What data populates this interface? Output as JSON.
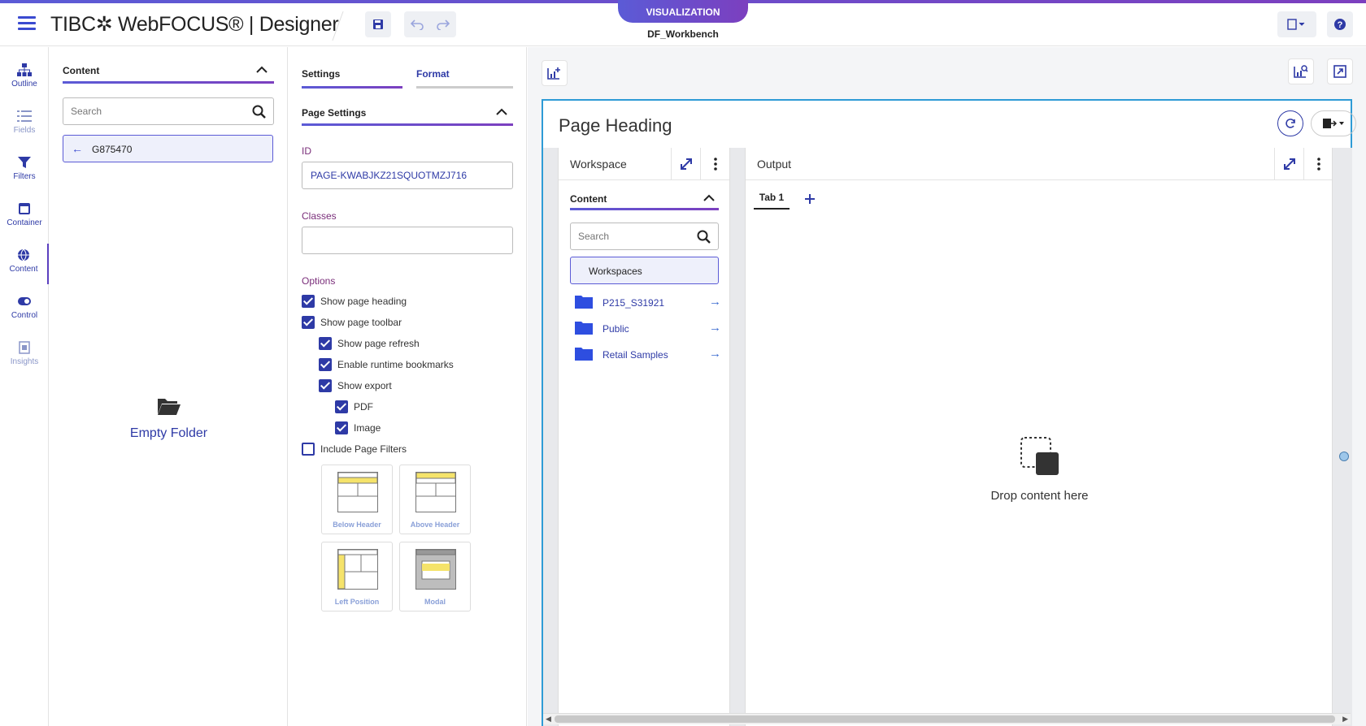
{
  "header": {
    "brand": "TIBC✲ WebFOCUS® | Designer",
    "mode_tab": "VISUALIZATION",
    "workbench_title": "DF_Workbench"
  },
  "rail": {
    "items": [
      {
        "label": "Outline",
        "icon": "sitemap-icon"
      },
      {
        "label": "Fields",
        "icon": "list-icon"
      },
      {
        "label": "Filters",
        "icon": "funnel-icon"
      },
      {
        "label": "Container",
        "icon": "container-icon"
      },
      {
        "label": "Content",
        "icon": "globe-icon"
      },
      {
        "label": "Control",
        "icon": "toggle-icon"
      },
      {
        "label": "Insights",
        "icon": "insights-icon"
      }
    ]
  },
  "content_panel": {
    "title": "Content",
    "search_placeholder": "Search",
    "breadcrumb": "G875470",
    "empty_label": "Empty Folder"
  },
  "settings_panel": {
    "tabs": [
      "Settings",
      "Format"
    ],
    "section_title": "Page Settings",
    "id_label": "ID",
    "id_value": "PAGE-KWABJKZ21SQUOTMZJ716",
    "classes_label": "Classes",
    "classes_value": "",
    "options_label": "Options",
    "options": [
      {
        "label": "Show page heading",
        "checked": true
      },
      {
        "label": "Show page toolbar",
        "checked": true
      },
      {
        "label": "Show page refresh",
        "checked": true
      },
      {
        "label": "Enable runtime bookmarks",
        "checked": true
      },
      {
        "label": "Show export",
        "checked": true
      },
      {
        "label": "PDF",
        "checked": true
      },
      {
        "label": "Image",
        "checked": true
      },
      {
        "label": "Include Page Filters",
        "checked": false
      }
    ],
    "filter_positions": [
      "Below Header",
      "Above Header",
      "Left Position",
      "Modal"
    ]
  },
  "canvas": {
    "page_heading": "Page Heading",
    "workspace_panel": {
      "title": "Workspace",
      "content_title": "Content",
      "search_placeholder": "Search",
      "root": "Workspaces",
      "folders": [
        "P215_S31921",
        "Public",
        "Retail Samples"
      ]
    },
    "output_panel": {
      "title": "Output",
      "tab": "Tab 1",
      "drop_text": "Drop content here"
    }
  },
  "colors": {
    "accent": "#2e3aa6",
    "gradient_start": "#5b5bd6",
    "gradient_end": "#7c3fbf",
    "page_border": "#2e9bd6"
  }
}
